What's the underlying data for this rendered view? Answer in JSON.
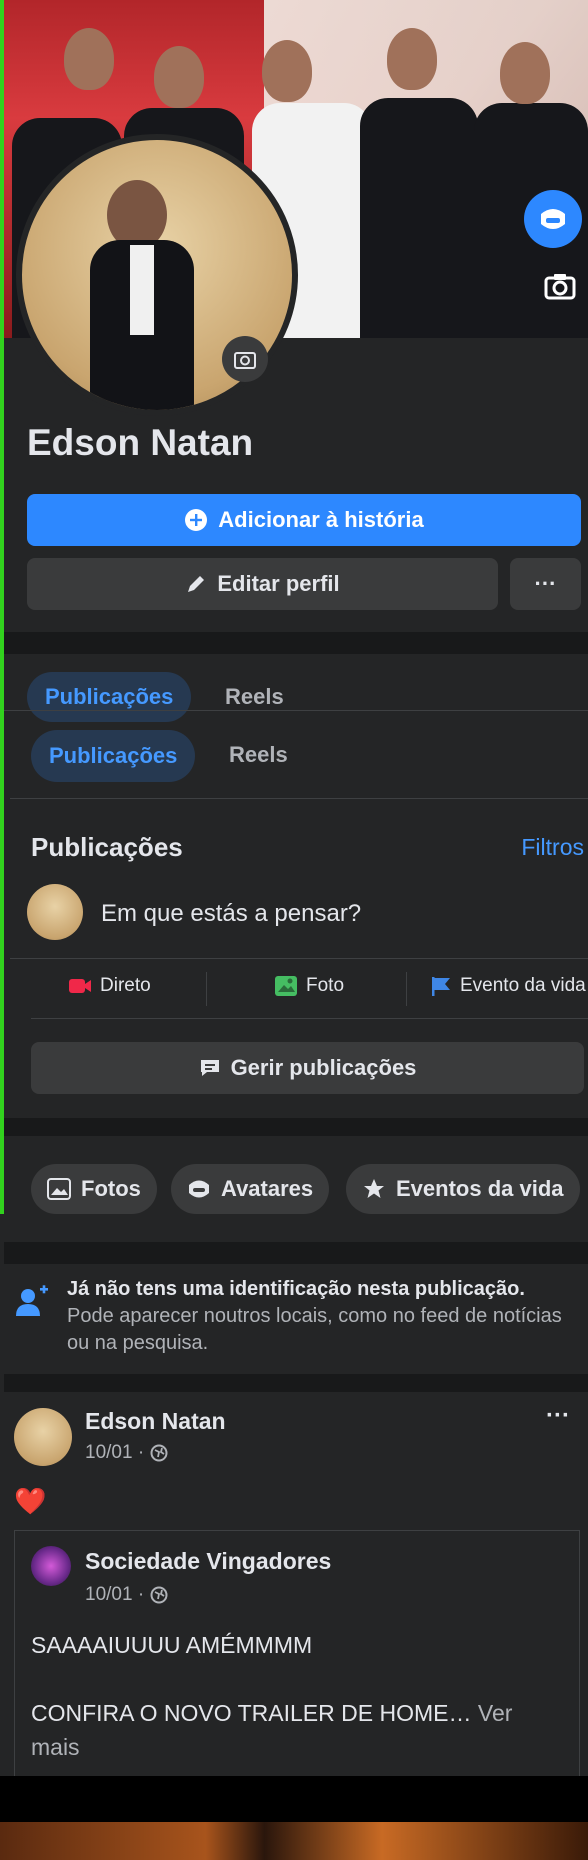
{
  "profile": {
    "name": "Edson Natan",
    "add_story": "Adicionar à história",
    "edit_profile": "Editar perfil",
    "more": "···"
  },
  "tabs": {
    "sticky": [
      "Publicações",
      "Reels"
    ],
    "main": [
      "Publicações",
      "Reels"
    ]
  },
  "posts_section": {
    "title": "Publicações",
    "filters": "Filtros",
    "composer_placeholder": "Em que estás a pensar?",
    "actions": [
      "Direto",
      "Foto",
      "Evento da vida"
    ],
    "manage": "Gerir publicações"
  },
  "chips": [
    "Fotos",
    "Avatares",
    "Eventos da vida"
  ],
  "notice": {
    "title": "Já não tens uma identificação nesta publicação.",
    "body": "Pode aparecer noutros locais, como no feed de notícias ou na pesquisa."
  },
  "post": {
    "author": "Edson Natan",
    "date": "10/01 ·",
    "more": "···",
    "reaction": "❤️",
    "shared": {
      "author": "Sociedade Vingadores",
      "date": "10/01 ·",
      "text1": "SAAAAIUUUU AMÉMMMM",
      "text2": "CONFIRA O NOVO TRAILER DE HOME…",
      "see_more": "Ver",
      "see_more_2": "mais"
    }
  },
  "colors": {
    "accent": "#2d88ff",
    "bg": "#242526",
    "separator": "#18191a",
    "indicator": "#32d21e"
  }
}
